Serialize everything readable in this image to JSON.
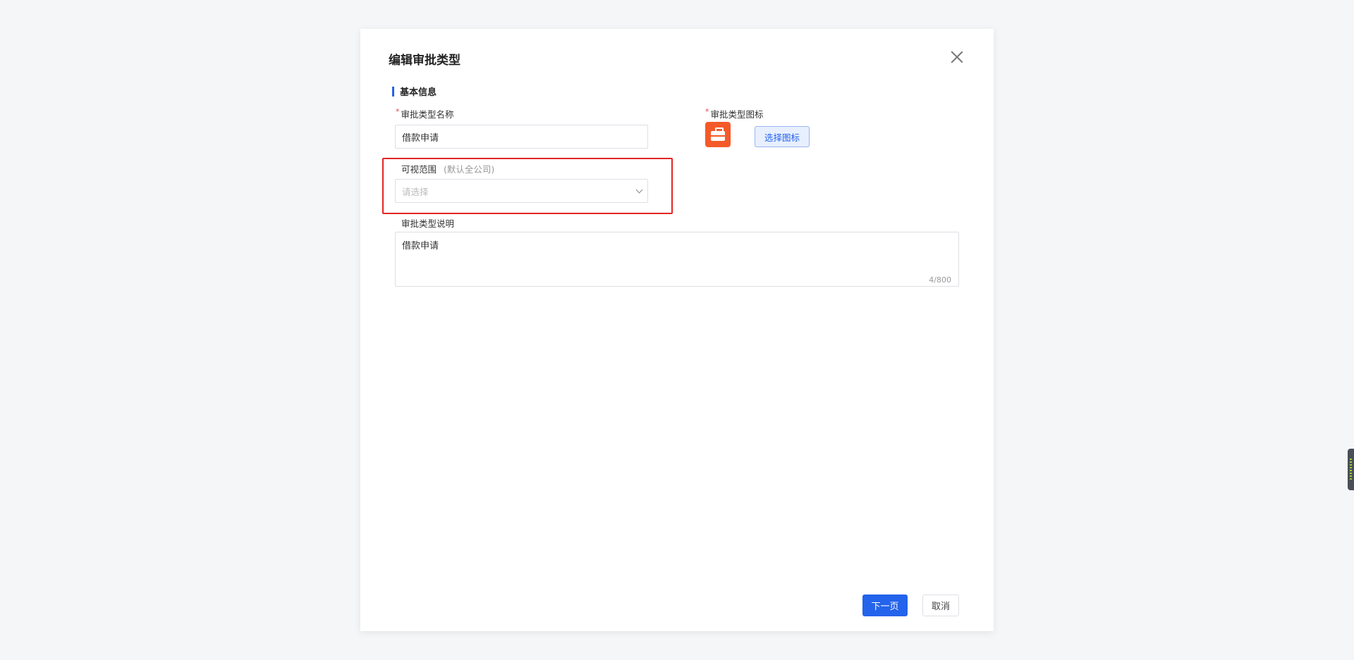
{
  "dialog": {
    "title": "编辑审批类型",
    "close_icon": "close-icon"
  },
  "section": {
    "title": "基本信息"
  },
  "form": {
    "name": {
      "required_mark": "*",
      "label": "审批类型名称",
      "value": "借款申请"
    },
    "icon": {
      "required_mark": "*",
      "label": "审批类型图标",
      "icon_name": "briefcase-icon",
      "icon_color": "#f45a29",
      "choose_label": "选择图标"
    },
    "visibility": {
      "label": "可视范围",
      "hint": "(默认全公司)",
      "placeholder": "请选择"
    },
    "description": {
      "label": "审批类型说明",
      "value": "借款申请",
      "counter": "4/800"
    }
  },
  "footer": {
    "next_label": "下一页",
    "cancel_label": "取消"
  },
  "colors": {
    "primary": "#2463eb",
    "highlight": "#e52424"
  }
}
